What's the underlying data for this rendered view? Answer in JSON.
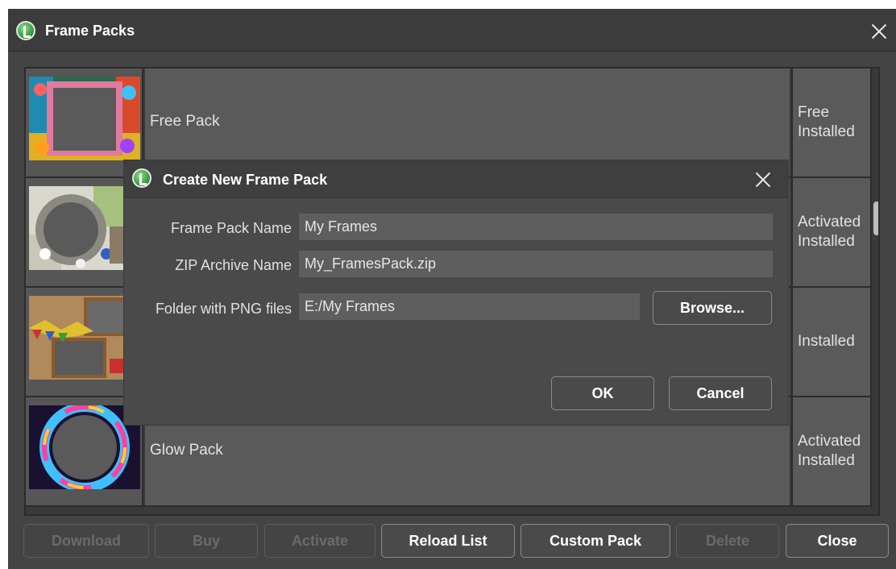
{
  "window": {
    "title": "Frame Packs"
  },
  "packs": [
    {
      "name": "Free Pack",
      "status": [
        "Free",
        "Installed"
      ]
    },
    {
      "name": "",
      "status": [
        "Activated",
        "Installed"
      ]
    },
    {
      "name": "",
      "status": [
        "Installed"
      ]
    },
    {
      "name": "Glow Pack",
      "status": [
        "Activated",
        "Installed"
      ]
    }
  ],
  "dialog": {
    "title": "Create New Frame Pack",
    "fields": {
      "pack_name_label": "Frame Pack Name",
      "pack_name_value": "My Frames",
      "zip_label": "ZIP Archive Name",
      "zip_value": "My_FramesPack.zip",
      "folder_label": "Folder with PNG files",
      "folder_value": "E:/My Frames"
    },
    "browse_label": "Browse...",
    "ok_label": "OK",
    "cancel_label": "Cancel"
  },
  "buttons": {
    "download": "Download",
    "buy": "Buy",
    "activate": "Activate",
    "reload": "Reload List",
    "custom": "Custom Pack",
    "delete": "Delete",
    "close": "Close"
  },
  "colors": {
    "window_bg": "#444444",
    "titlebar_bg": "#3c3c3c",
    "cell_bg": "#5a5a5a",
    "logo_green": "#2f8f3a"
  },
  "icons": [
    "app-logo-icon",
    "close-icon",
    "scrollbar-thumb"
  ]
}
